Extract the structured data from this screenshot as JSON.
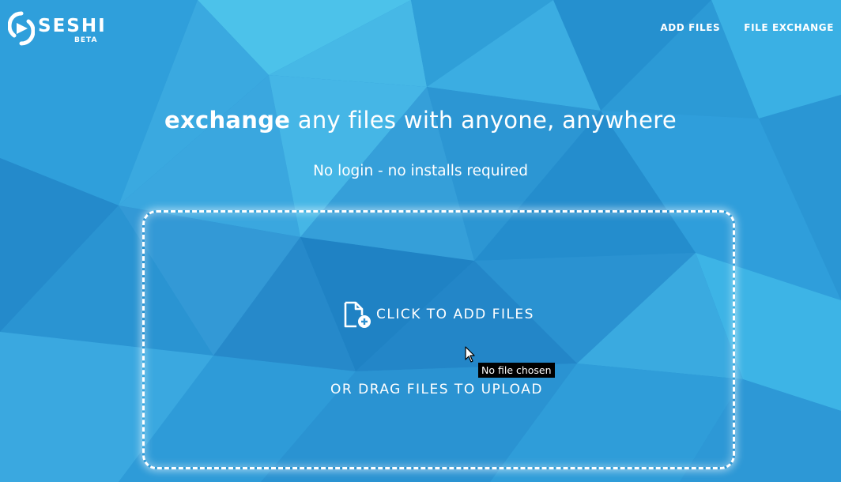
{
  "brand": {
    "name": "SESHI",
    "badge": "BETA"
  },
  "nav": {
    "items": [
      {
        "label": "ADD FILES"
      },
      {
        "label": "FILE EXCHANGE"
      }
    ]
  },
  "hero": {
    "headline_bold": "exchange",
    "headline_rest": " any files with anyone, anywhere",
    "subline": "No login - no installs required"
  },
  "dropzone": {
    "add_label": "CLICK TO ADD FILES",
    "drag_label": "OR DRAG FILES TO UPLOAD",
    "file_input_tooltip": "No file chosen"
  },
  "icons": {
    "logo": "play-arc-logo-icon",
    "add_file": "file-add-icon",
    "cursor": "mouse-pointer-icon"
  },
  "colors": {
    "background": "#2a93d0",
    "text": "#ffffff",
    "tooltip_bg": "#000000"
  }
}
